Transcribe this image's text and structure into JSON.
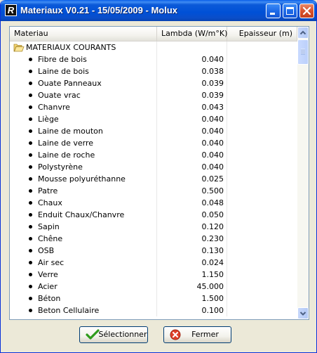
{
  "window": {
    "title": "Materiaux V0.21 - 15/05/2009 - Molux",
    "app_icon_letter": "R"
  },
  "table": {
    "columns": [
      "Materiau",
      "Lambda (W/m°K)",
      "Epaisseur (m)"
    ],
    "group": "MATERIAUX COURANTS",
    "items": [
      {
        "name": "Fibre de bois",
        "lambda": "0.040",
        "epaisseur": ""
      },
      {
        "name": "Laine de bois",
        "lambda": "0.038",
        "epaisseur": ""
      },
      {
        "name": "Ouate Panneaux",
        "lambda": "0.039",
        "epaisseur": ""
      },
      {
        "name": "Ouate vrac",
        "lambda": "0.039",
        "epaisseur": ""
      },
      {
        "name": "Chanvre",
        "lambda": "0.043",
        "epaisseur": ""
      },
      {
        "name": "Liège",
        "lambda": "0.040",
        "epaisseur": ""
      },
      {
        "name": "Laine de mouton",
        "lambda": "0.040",
        "epaisseur": ""
      },
      {
        "name": "Laine de verre",
        "lambda": "0.040",
        "epaisseur": ""
      },
      {
        "name": "Laine de roche",
        "lambda": "0.040",
        "epaisseur": ""
      },
      {
        "name": "Polystyrène",
        "lambda": "0.040",
        "epaisseur": ""
      },
      {
        "name": "Mousse polyuréthanne",
        "lambda": "0.025",
        "epaisseur": ""
      },
      {
        "name": "Patre",
        "lambda": "0.500",
        "epaisseur": ""
      },
      {
        "name": "Chaux",
        "lambda": "0.048",
        "epaisseur": ""
      },
      {
        "name": "Enduit Chaux/Chanvre",
        "lambda": "0.050",
        "epaisseur": ""
      },
      {
        "name": "Sapin",
        "lambda": "0.120",
        "epaisseur": ""
      },
      {
        "name": "Chêne",
        "lambda": "0.230",
        "epaisseur": ""
      },
      {
        "name": "OSB",
        "lambda": "0.130",
        "epaisseur": ""
      },
      {
        "name": "Air sec",
        "lambda": "0.024",
        "epaisseur": ""
      },
      {
        "name": "Verre",
        "lambda": "1.150",
        "epaisseur": ""
      },
      {
        "name": "Acier",
        "lambda": "45.000",
        "epaisseur": ""
      },
      {
        "name": "Béton",
        "lambda": "1.500",
        "epaisseur": ""
      },
      {
        "name": "Beton Cellulaire",
        "lambda": "0.100",
        "epaisseur": ""
      }
    ]
  },
  "buttons": {
    "select_label": "Sélectionner",
    "close_label": "Fermer"
  },
  "icons": {
    "window": "app-icon",
    "group": "folder-open-icon",
    "select": "checkmark-icon",
    "close": "close-circle-icon"
  },
  "colors": {
    "titlebar": "#0050d6",
    "window_bg": "#ece9d8",
    "border": "#7f9db9"
  }
}
